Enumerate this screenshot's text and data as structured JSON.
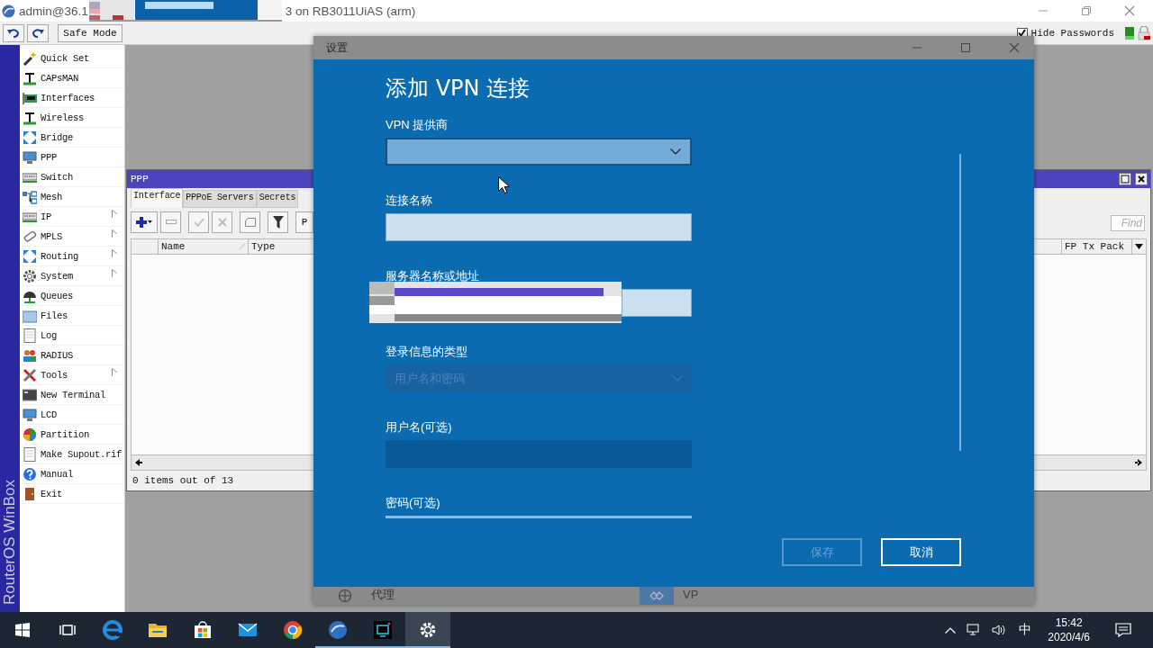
{
  "window": {
    "title_start": "admin@36.1",
    "title_end": "3 on RB3011UiAS (arm)"
  },
  "toolbar": {
    "safe_mode": "Safe Mode",
    "hide_passwords": {
      "label": "Hide Passwords",
      "checked": true
    }
  },
  "side_label": "RouterOS WinBox",
  "menu": [
    {
      "label": "Quick Set",
      "submenu": false
    },
    {
      "label": "CAPsMAN",
      "submenu": false
    },
    {
      "label": "Interfaces",
      "submenu": false
    },
    {
      "label": "Wireless",
      "submenu": false
    },
    {
      "label": "Bridge",
      "submenu": false
    },
    {
      "label": "PPP",
      "submenu": false
    },
    {
      "label": "Switch",
      "submenu": false
    },
    {
      "label": "Mesh",
      "submenu": false
    },
    {
      "label": "IP",
      "submenu": true
    },
    {
      "label": "MPLS",
      "submenu": true
    },
    {
      "label": "Routing",
      "submenu": true
    },
    {
      "label": "System",
      "submenu": true
    },
    {
      "label": "Queues",
      "submenu": false
    },
    {
      "label": "Files",
      "submenu": false
    },
    {
      "label": "Log",
      "submenu": false
    },
    {
      "label": "RADIUS",
      "submenu": false
    },
    {
      "label": "Tools",
      "submenu": true
    },
    {
      "label": "New Terminal",
      "submenu": false
    },
    {
      "label": "LCD",
      "submenu": false
    },
    {
      "label": "Partition",
      "submenu": false
    },
    {
      "label": "Make Supout.rif",
      "submenu": false
    },
    {
      "label": "Manual",
      "submenu": false
    },
    {
      "label": "Exit",
      "submenu": false
    }
  ],
  "ppp_window": {
    "title": "PPP",
    "tabs": [
      {
        "label": "Interface",
        "selected": true
      },
      {
        "label": "PPPoE Servers",
        "selected": false
      },
      {
        "label": "Secrets",
        "selected": false
      }
    ],
    "toolbar_text_button": "P",
    "find_placeholder": "Find",
    "columns": [
      "Name",
      "Type",
      "FP Tx Pack"
    ],
    "status": "0 items out of 13"
  },
  "settings_window": {
    "title": "设置",
    "items": [
      {
        "label": "代理",
        "highlighted": false
      },
      {
        "label": "VP",
        "highlighted": true
      }
    ]
  },
  "vpn_dialog": {
    "heading": "添加 VPN 连接",
    "fields": [
      {
        "kind": "dropdown",
        "label": "VPN 提供商",
        "disabled": false
      },
      {
        "kind": "text",
        "label": "连接名称",
        "disabled": false
      },
      {
        "kind": "text",
        "label": "服务器名称或地址",
        "disabled": false,
        "redacted": true
      },
      {
        "kind": "dropdown",
        "label": "登录信息的类型",
        "value": "用户名和密码",
        "disabled": true
      },
      {
        "kind": "text",
        "label": "用户名(可选)",
        "disabled": true
      },
      {
        "kind": "text",
        "label": "密码(可选)",
        "disabled": true,
        "cut": true
      }
    ],
    "buttons": [
      {
        "label": "保存",
        "disabled": true
      },
      {
        "label": "取消",
        "disabled": false
      }
    ]
  },
  "taskbar": {
    "apps": [
      {
        "running": false,
        "active": false
      },
      {
        "running": false,
        "active": false
      },
      {
        "running": false,
        "active": false
      },
      {
        "running": false,
        "active": false
      },
      {
        "running": false,
        "active": false
      },
      {
        "running": true,
        "active": false
      },
      {
        "running": true,
        "active": false
      },
      {
        "running": true,
        "active": true
      }
    ],
    "ime": "中",
    "time": "15:42",
    "date": "2020/4/6"
  }
}
